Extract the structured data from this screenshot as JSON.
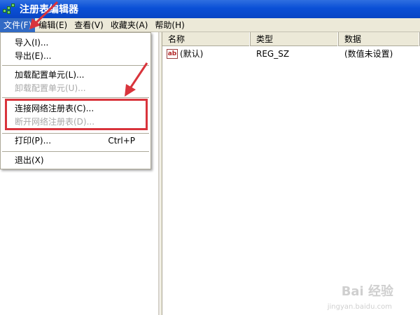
{
  "window": {
    "title": "注册表编辑器"
  },
  "menubar": {
    "items": [
      {
        "label": "文件(F)",
        "active": true
      },
      {
        "label": "编辑(E)",
        "active": false
      },
      {
        "label": "查看(V)",
        "active": false
      },
      {
        "label": "收藏夹(A)",
        "active": false
      },
      {
        "label": "帮助(H)",
        "active": false
      }
    ]
  },
  "file_menu": {
    "import": "导入(I)...",
    "export": "导出(E)...",
    "load_hive": "加载配置单元(L)...",
    "unload_hive": "卸载配置单元(U)...",
    "connect_network_registry": "连接网络注册表(C)...",
    "disconnect_network_registry": "断开网络注册表(D)...",
    "print": "打印(P)...",
    "print_shortcut": "Ctrl+P",
    "exit": "退出(X)"
  },
  "list": {
    "headers": [
      "名称",
      "类型",
      "数据"
    ],
    "rows": [
      {
        "name": "(默认)",
        "type": "REG_SZ",
        "data": "(数值未设置)",
        "icon": "string-value-icon"
      }
    ]
  },
  "annotation_color": "#d9343c",
  "watermark": {
    "text": "Bai 经验",
    "sub": "jingyan.baidu.com"
  }
}
